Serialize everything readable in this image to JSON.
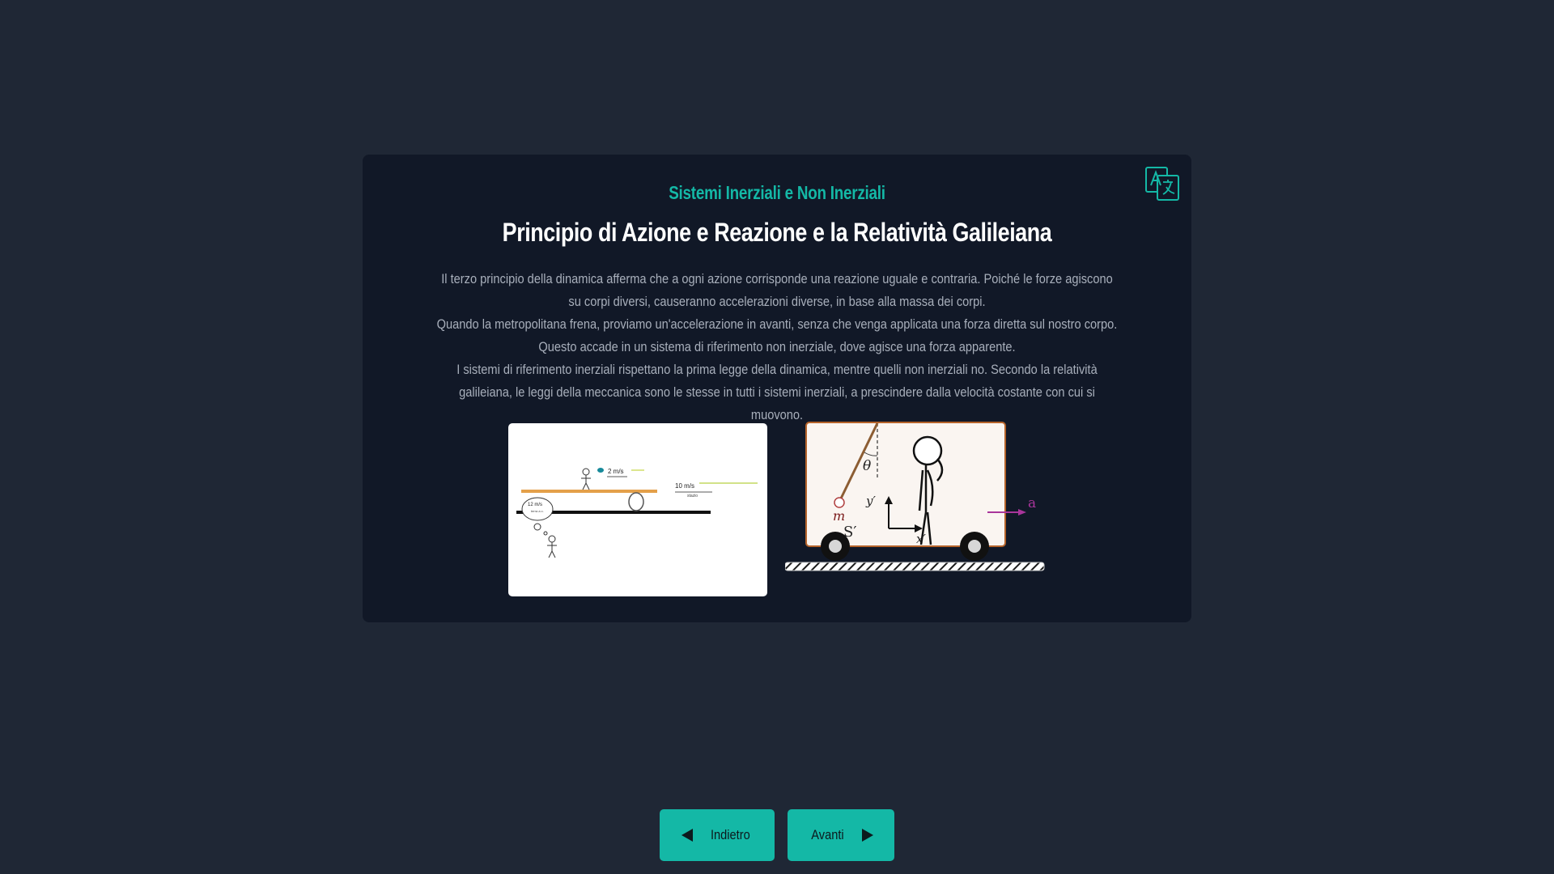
{
  "card": {
    "subtitle": "Sistemi Inerziali e Non Inerziali",
    "title": "Principio di Azione e Reazione e la Relatività Galileiana",
    "paragraphs": [
      "Il terzo principio della dinamica afferma che a ogni azione corrisponde una reazione uguale e contraria. Poiché le forze agiscono su corpi diversi, causeranno accelerazioni diverse, in base alla massa dei corpi.",
      "Quando la metropolitana frena, proviamo un'accelerazione in avanti, senza che venga applicata una forza diretta sul nostro corpo. Questo accade in un sistema di riferimento non inerziale, dove agisce una forza apparente.",
      "I sistemi di riferimento inerziali rispettano la prima legge della dinamica, mentre quelli non inerziali no. Secondo la relatività galileiana, le leggi della meccanica sono le stesse in tutti i sistemi inerziali, a prescindere dalla velocità costante con cui si muovono."
    ],
    "translate_icon": "translate-icon"
  },
  "left_figure": {
    "label_person_speed": "2 m/s",
    "label_train_speed": "10 m/s",
    "label_train_sub": "stazio",
    "label_observer_speed": "12 m/s",
    "label_observer_sub": "terra a c."
  },
  "right_figure": {
    "label_theta": "θ",
    "label_m": "m",
    "label_y": "y′",
    "label_x": "x′",
    "label_frame": "S′",
    "label_a": "a"
  },
  "nav": {
    "back_label": "Indietro",
    "next_label": "Avanti",
    "back_icon": "triangle-left-icon",
    "next_icon": "triangle-right-icon"
  },
  "colors": {
    "background": "#1f2735",
    "card": "#111827",
    "accent": "#14b8a6",
    "body_text": "#a8afbb"
  }
}
